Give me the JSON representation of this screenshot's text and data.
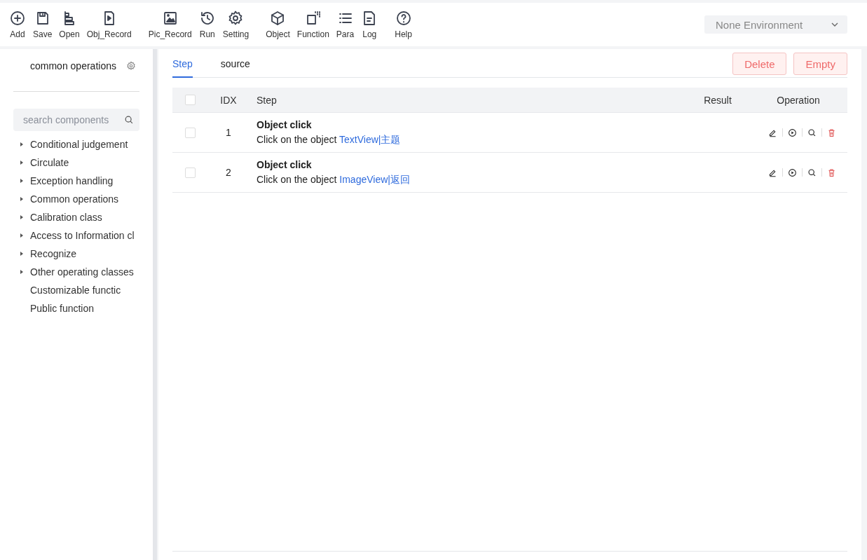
{
  "toolbar": [
    {
      "kind": "add",
      "label": "Add"
    },
    {
      "kind": "save",
      "label": "Save"
    },
    {
      "kind": "open",
      "label": "Open"
    },
    {
      "kind": "objrecord",
      "label": "Obj_Record"
    },
    {
      "kind": "picrecord",
      "label": "Pic_Record"
    },
    {
      "kind": "run",
      "label": "Run"
    },
    {
      "kind": "setting",
      "label": "Setting"
    },
    {
      "kind": "object",
      "label": "Object"
    },
    {
      "kind": "function",
      "label": "Function"
    },
    {
      "kind": "para",
      "label": "Para"
    },
    {
      "kind": "log",
      "label": "Log"
    },
    {
      "kind": "help",
      "label": "Help"
    }
  ],
  "environment": {
    "value": "None Environment"
  },
  "sidebar": {
    "title": "common operations",
    "search": {
      "placeholder": "search components"
    },
    "items": [
      {
        "label": "Conditional judgement",
        "kind": "group",
        "expanded": false
      },
      {
        "label": "Circulate",
        "kind": "group",
        "expanded": false
      },
      {
        "label": "Exception handling",
        "kind": "group",
        "expanded": false
      },
      {
        "label": "Common operations",
        "kind": "group",
        "expanded": false
      },
      {
        "label": "Calibration class",
        "kind": "group",
        "expanded": false
      },
      {
        "label": "Access to Information cl",
        "kind": "group",
        "expanded": false
      },
      {
        "label": "Recognize",
        "kind": "group",
        "expanded": false
      },
      {
        "label": "Other operating classes",
        "kind": "group",
        "expanded": false
      },
      {
        "label": "Customizable functic",
        "kind": "leaf"
      },
      {
        "label": "Public function",
        "kind": "leaf"
      }
    ]
  },
  "tabs": [
    {
      "label": "Step",
      "selected": true
    },
    {
      "label": "source",
      "selected": false
    }
  ],
  "buttons": [
    "Delete",
    "Empty"
  ],
  "table": {
    "columns": [
      "IDX",
      "Step",
      "Result",
      "Operation"
    ],
    "header_checked": false,
    "rows": [
      {
        "checked": false,
        "idx": "1",
        "title": "Object click",
        "text": "Click on the object",
        "target": "TextView|主题"
      },
      {
        "checked": false,
        "idx": "2",
        "title": "Object click",
        "text": "Click on the object",
        "target": "ImageView|返回"
      }
    ]
  }
}
